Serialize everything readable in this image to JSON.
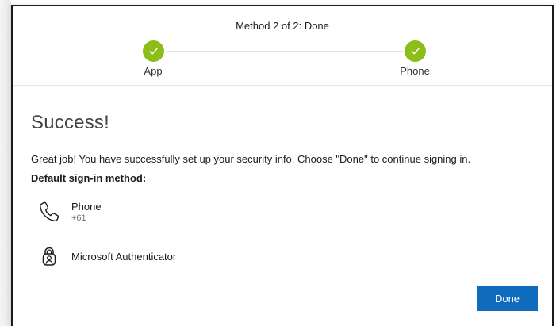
{
  "progress": {
    "title": "Method 2 of 2: Done",
    "steps": [
      {
        "label": "App",
        "status": "complete",
        "icon": "checkmark-icon"
      },
      {
        "label": "Phone",
        "status": "complete",
        "icon": "checkmark-icon"
      }
    ]
  },
  "main": {
    "title": "Success!",
    "message": "Great job! You have successfully set up your security info. Choose \"Done\" to continue signing in.",
    "default_heading": "Default sign-in method:",
    "methods": [
      {
        "name": "Phone",
        "detail": "+61",
        "icon": "phone-icon"
      },
      {
        "name": "Microsoft Authenticator",
        "icon": "authenticator-lock-icon"
      }
    ],
    "done_label": "Done"
  },
  "colors": {
    "check_green": "#8cbd18",
    "primary_blue": "#0f6cbd"
  }
}
